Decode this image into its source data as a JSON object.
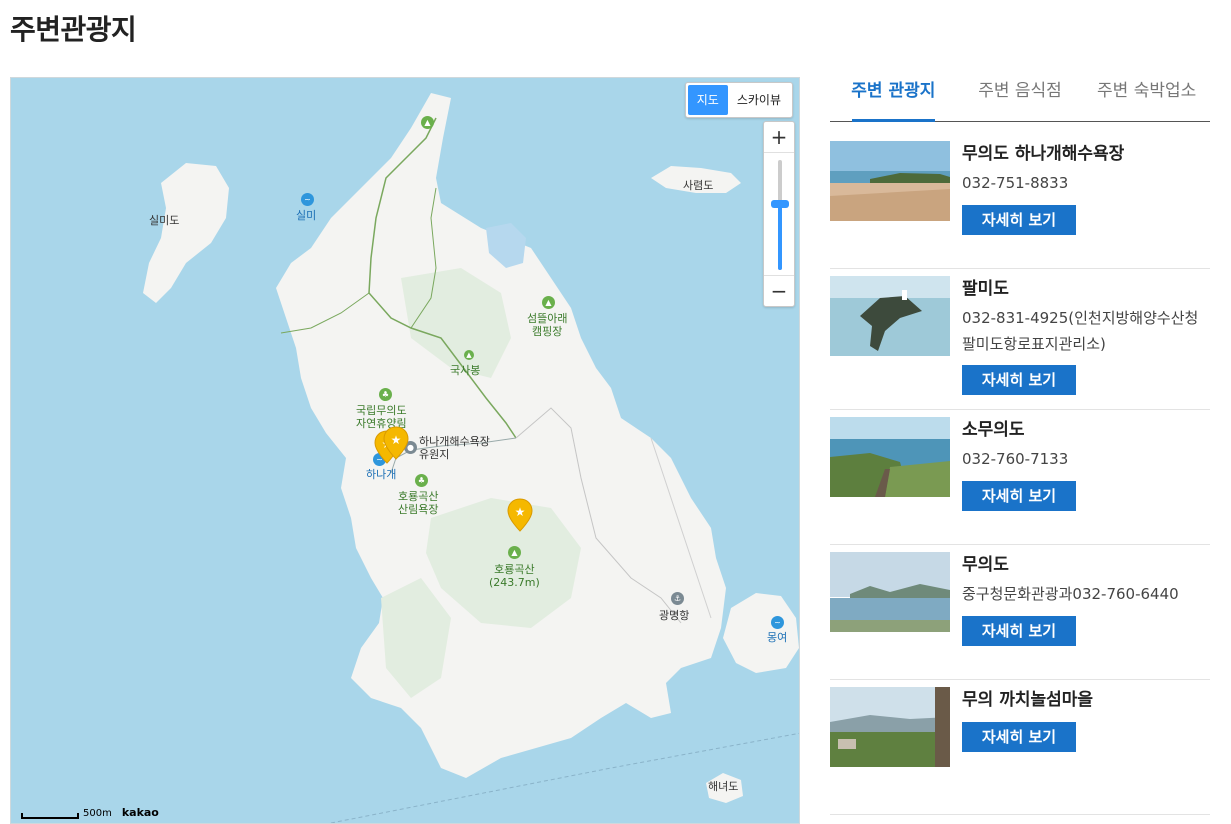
{
  "page": {
    "title": "주변관광지"
  },
  "map": {
    "type_buttons": [
      "지도",
      "스카이뷰"
    ],
    "zoom_in": "+",
    "zoom_out": "−",
    "zoom_level_fraction": 0.6,
    "scale_label": "500m",
    "provider": "kakao",
    "labels": {
      "silmido": "실미도",
      "silmi": "실미",
      "saryeokdo": "사렴도",
      "camping": "섬뜰아래\n캠핑장",
      "guksabong": "국사봉",
      "forest": "국립무의도\n자연휴양림",
      "hanagae_resort": "하나개해수욕장\n유원지",
      "hanagae": "하나개",
      "horyong_forest": "호룡곡산\n산림욕장",
      "horyong_peak": "호룡곡산\n(243.7m)",
      "gwangmyeong": "광명항",
      "mongyeo": "몽여",
      "haenyeodo": "해녀도"
    },
    "colors": {
      "sea": "#a9d6ea",
      "land": "#f4f4f2",
      "accent": "#3396ff",
      "marker": "#f5b800"
    }
  },
  "tabs": [
    {
      "label": "주변 관광지",
      "active": true
    },
    {
      "label": "주변 음식점",
      "active": false
    },
    {
      "label": "주변 숙박업소",
      "active": false
    }
  ],
  "detail_label": "자세히 보기",
  "places": [
    {
      "name": "무의도 하나개해수욕장",
      "tel": "032-751-8833",
      "image": "beach"
    },
    {
      "name": "팔미도",
      "tel": "032-831-4925(인천지방해양수산청 팔미도항로표지관리소)",
      "image": "island"
    },
    {
      "name": "소무의도",
      "tel": "032-760-7133",
      "image": "coast"
    },
    {
      "name": "무의도",
      "tel": "중구청문화관광과032-760-6440",
      "image": "bay"
    },
    {
      "name": "무의 까치놀섬마을",
      "tel": "",
      "image": "village"
    }
  ]
}
